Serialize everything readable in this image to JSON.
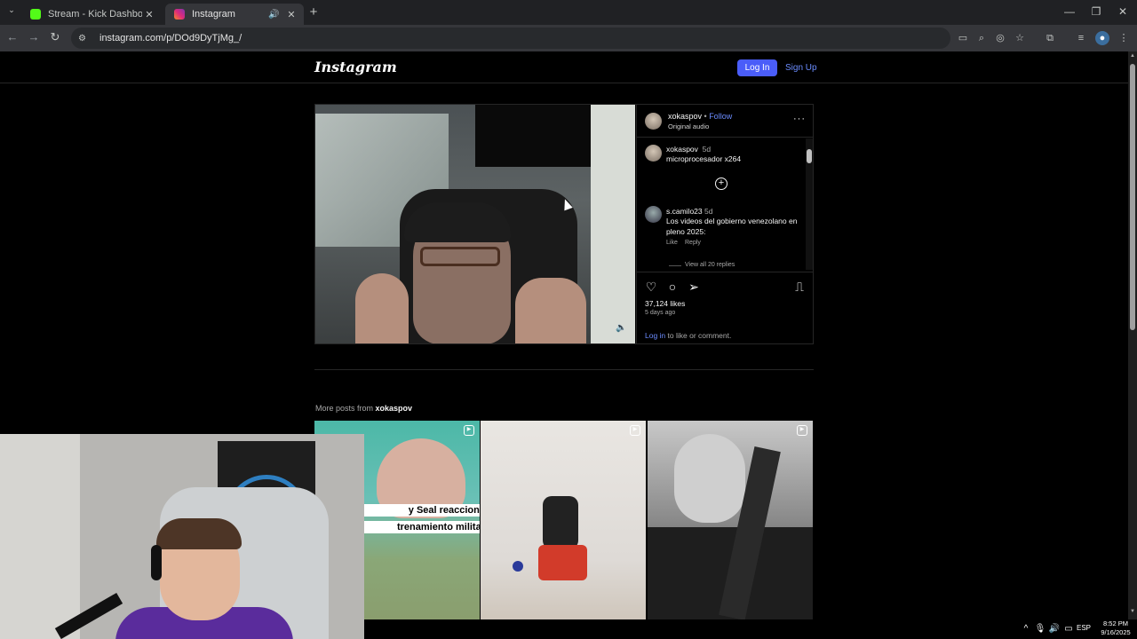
{
  "browser": {
    "tabs": [
      {
        "title": "Stream - Kick Dashboard",
        "favicon_color": "#53fc18",
        "active": false
      },
      {
        "title": "Instagram",
        "favicon_color": "#e1306c",
        "active": true
      }
    ],
    "new_tab": "+",
    "url": "instagram.com/p/DOd9DyTjMg_/",
    "window_controls": [
      "—",
      "❐",
      "✕"
    ]
  },
  "instagram": {
    "logo": "Instagram",
    "login_label": "Log In",
    "signup_label": "Sign Up",
    "post": {
      "username": "xokaspov",
      "separator": " • ",
      "follow_label": "Follow",
      "audio": "Original audio",
      "more": "···",
      "caption": {
        "username": "xokaspov",
        "time": "5d",
        "text": "microprocesador x264"
      },
      "comment": {
        "username": "s.camilo23",
        "time": "5d",
        "text": "Los videos del gobierno venezolano en pleno 2025:",
        "like_label": "Like",
        "reply_label": "Reply",
        "view_replies": "View all 20 replies"
      },
      "likes": "37,124 likes",
      "posted": "5 days ago",
      "login_link": "Log in",
      "login_suffix": " to like or comment."
    },
    "more_posts": {
      "prefix": "More posts from ",
      "username": "xokaspov",
      "thumbs": [
        {
          "caption_line1": "y Seal reacciona",
          "caption_line2": "trenamiento militar"
        },
        {},
        {}
      ]
    }
  },
  "taskbar": {
    "language": "ESP",
    "time": "8:52 PM",
    "date": "9/16/2025"
  }
}
